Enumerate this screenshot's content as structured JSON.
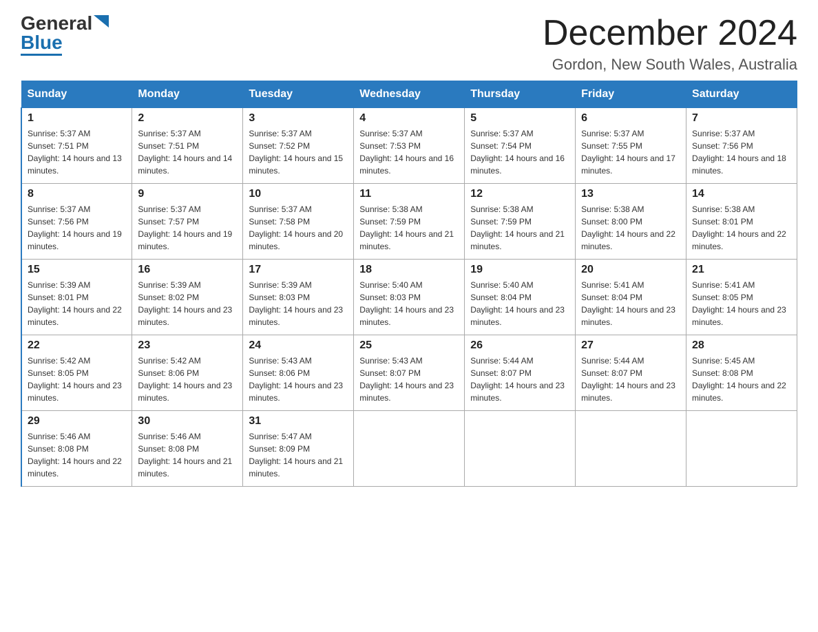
{
  "header": {
    "logo": {
      "general": "General",
      "blue": "Blue"
    },
    "title": "December 2024",
    "subtitle": "Gordon, New South Wales, Australia"
  },
  "calendar": {
    "days_of_week": [
      "Sunday",
      "Monday",
      "Tuesday",
      "Wednesday",
      "Thursday",
      "Friday",
      "Saturday"
    ],
    "weeks": [
      [
        {
          "day": "1",
          "sunrise": "5:37 AM",
          "sunset": "7:51 PM",
          "daylight": "14 hours and 13 minutes."
        },
        {
          "day": "2",
          "sunrise": "5:37 AM",
          "sunset": "7:51 PM",
          "daylight": "14 hours and 14 minutes."
        },
        {
          "day": "3",
          "sunrise": "5:37 AM",
          "sunset": "7:52 PM",
          "daylight": "14 hours and 15 minutes."
        },
        {
          "day": "4",
          "sunrise": "5:37 AM",
          "sunset": "7:53 PM",
          "daylight": "14 hours and 16 minutes."
        },
        {
          "day": "5",
          "sunrise": "5:37 AM",
          "sunset": "7:54 PM",
          "daylight": "14 hours and 16 minutes."
        },
        {
          "day": "6",
          "sunrise": "5:37 AM",
          "sunset": "7:55 PM",
          "daylight": "14 hours and 17 minutes."
        },
        {
          "day": "7",
          "sunrise": "5:37 AM",
          "sunset": "7:56 PM",
          "daylight": "14 hours and 18 minutes."
        }
      ],
      [
        {
          "day": "8",
          "sunrise": "5:37 AM",
          "sunset": "7:56 PM",
          "daylight": "14 hours and 19 minutes."
        },
        {
          "day": "9",
          "sunrise": "5:37 AM",
          "sunset": "7:57 PM",
          "daylight": "14 hours and 19 minutes."
        },
        {
          "day": "10",
          "sunrise": "5:37 AM",
          "sunset": "7:58 PM",
          "daylight": "14 hours and 20 minutes."
        },
        {
          "day": "11",
          "sunrise": "5:38 AM",
          "sunset": "7:59 PM",
          "daylight": "14 hours and 21 minutes."
        },
        {
          "day": "12",
          "sunrise": "5:38 AM",
          "sunset": "7:59 PM",
          "daylight": "14 hours and 21 minutes."
        },
        {
          "day": "13",
          "sunrise": "5:38 AM",
          "sunset": "8:00 PM",
          "daylight": "14 hours and 22 minutes."
        },
        {
          "day": "14",
          "sunrise": "5:38 AM",
          "sunset": "8:01 PM",
          "daylight": "14 hours and 22 minutes."
        }
      ],
      [
        {
          "day": "15",
          "sunrise": "5:39 AM",
          "sunset": "8:01 PM",
          "daylight": "14 hours and 22 minutes."
        },
        {
          "day": "16",
          "sunrise": "5:39 AM",
          "sunset": "8:02 PM",
          "daylight": "14 hours and 23 minutes."
        },
        {
          "day": "17",
          "sunrise": "5:39 AM",
          "sunset": "8:03 PM",
          "daylight": "14 hours and 23 minutes."
        },
        {
          "day": "18",
          "sunrise": "5:40 AM",
          "sunset": "8:03 PM",
          "daylight": "14 hours and 23 minutes."
        },
        {
          "day": "19",
          "sunrise": "5:40 AM",
          "sunset": "8:04 PM",
          "daylight": "14 hours and 23 minutes."
        },
        {
          "day": "20",
          "sunrise": "5:41 AM",
          "sunset": "8:04 PM",
          "daylight": "14 hours and 23 minutes."
        },
        {
          "day": "21",
          "sunrise": "5:41 AM",
          "sunset": "8:05 PM",
          "daylight": "14 hours and 23 minutes."
        }
      ],
      [
        {
          "day": "22",
          "sunrise": "5:42 AM",
          "sunset": "8:05 PM",
          "daylight": "14 hours and 23 minutes."
        },
        {
          "day": "23",
          "sunrise": "5:42 AM",
          "sunset": "8:06 PM",
          "daylight": "14 hours and 23 minutes."
        },
        {
          "day": "24",
          "sunrise": "5:43 AM",
          "sunset": "8:06 PM",
          "daylight": "14 hours and 23 minutes."
        },
        {
          "day": "25",
          "sunrise": "5:43 AM",
          "sunset": "8:07 PM",
          "daylight": "14 hours and 23 minutes."
        },
        {
          "day": "26",
          "sunrise": "5:44 AM",
          "sunset": "8:07 PM",
          "daylight": "14 hours and 23 minutes."
        },
        {
          "day": "27",
          "sunrise": "5:44 AM",
          "sunset": "8:07 PM",
          "daylight": "14 hours and 23 minutes."
        },
        {
          "day": "28",
          "sunrise": "5:45 AM",
          "sunset": "8:08 PM",
          "daylight": "14 hours and 22 minutes."
        }
      ],
      [
        {
          "day": "29",
          "sunrise": "5:46 AM",
          "sunset": "8:08 PM",
          "daylight": "14 hours and 22 minutes."
        },
        {
          "day": "30",
          "sunrise": "5:46 AM",
          "sunset": "8:08 PM",
          "daylight": "14 hours and 21 minutes."
        },
        {
          "day": "31",
          "sunrise": "5:47 AM",
          "sunset": "8:09 PM",
          "daylight": "14 hours and 21 minutes."
        },
        null,
        null,
        null,
        null
      ]
    ]
  }
}
